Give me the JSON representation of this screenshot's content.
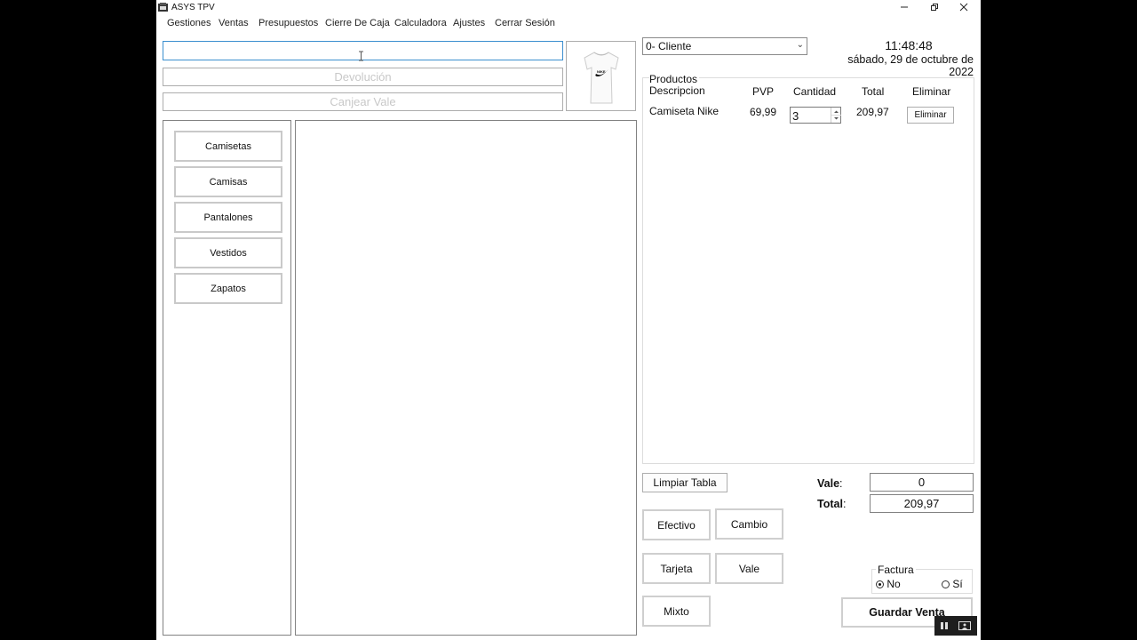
{
  "window": {
    "title": "ASYS TPV"
  },
  "menu": [
    "Gestiones",
    "Ventas",
    "Presupuestos",
    "Cierre De Caja",
    "Calculadora",
    "Ajustes",
    "Cerrar Sesión"
  ],
  "search": {
    "value": "",
    "placeholder": ""
  },
  "devolucion_placeholder": "Devolución",
  "canjear_placeholder": "Canjear Vale",
  "categories": [
    "Camisetas",
    "Camisas",
    "Pantalones",
    "Vestidos",
    "Zapatos"
  ],
  "customer_select": {
    "selected": "0- Cliente"
  },
  "clock": {
    "time": "11:48:48",
    "date": "sábado, 29 de octubre de 2022"
  },
  "products": {
    "title": "Productos",
    "headers": {
      "descripcion": "Descripcion",
      "pvp": "PVP",
      "cantidad": "Cantidad",
      "total": "Total",
      "eliminar": "Eliminar"
    },
    "rows": [
      {
        "descripcion": "Camiseta Nike",
        "pvp": "69,99",
        "cantidad": "3",
        "total": "209,97",
        "eliminar_label": "Eliminar"
      }
    ]
  },
  "actions": {
    "limpiar": "Limpiar Tabla",
    "efectivo": "Efectivo",
    "cambio": "Cambio",
    "tarjeta": "Tarjeta",
    "vale": "Vale",
    "mixto": "Mixto",
    "guardar": "Guardar Venta"
  },
  "summary": {
    "vale_label": "Vale",
    "vale_value": "0",
    "total_label": "Total",
    "total_value": "209,97"
  },
  "factura": {
    "label": "Factura",
    "no": "No",
    "si": "Sí",
    "selected": "No"
  },
  "icons": [
    "app-icon",
    "minimize-icon",
    "restore-icon",
    "close-icon",
    "chevron-down-icon",
    "tshirt-icon",
    "pause-icon",
    "screen-icon"
  ]
}
